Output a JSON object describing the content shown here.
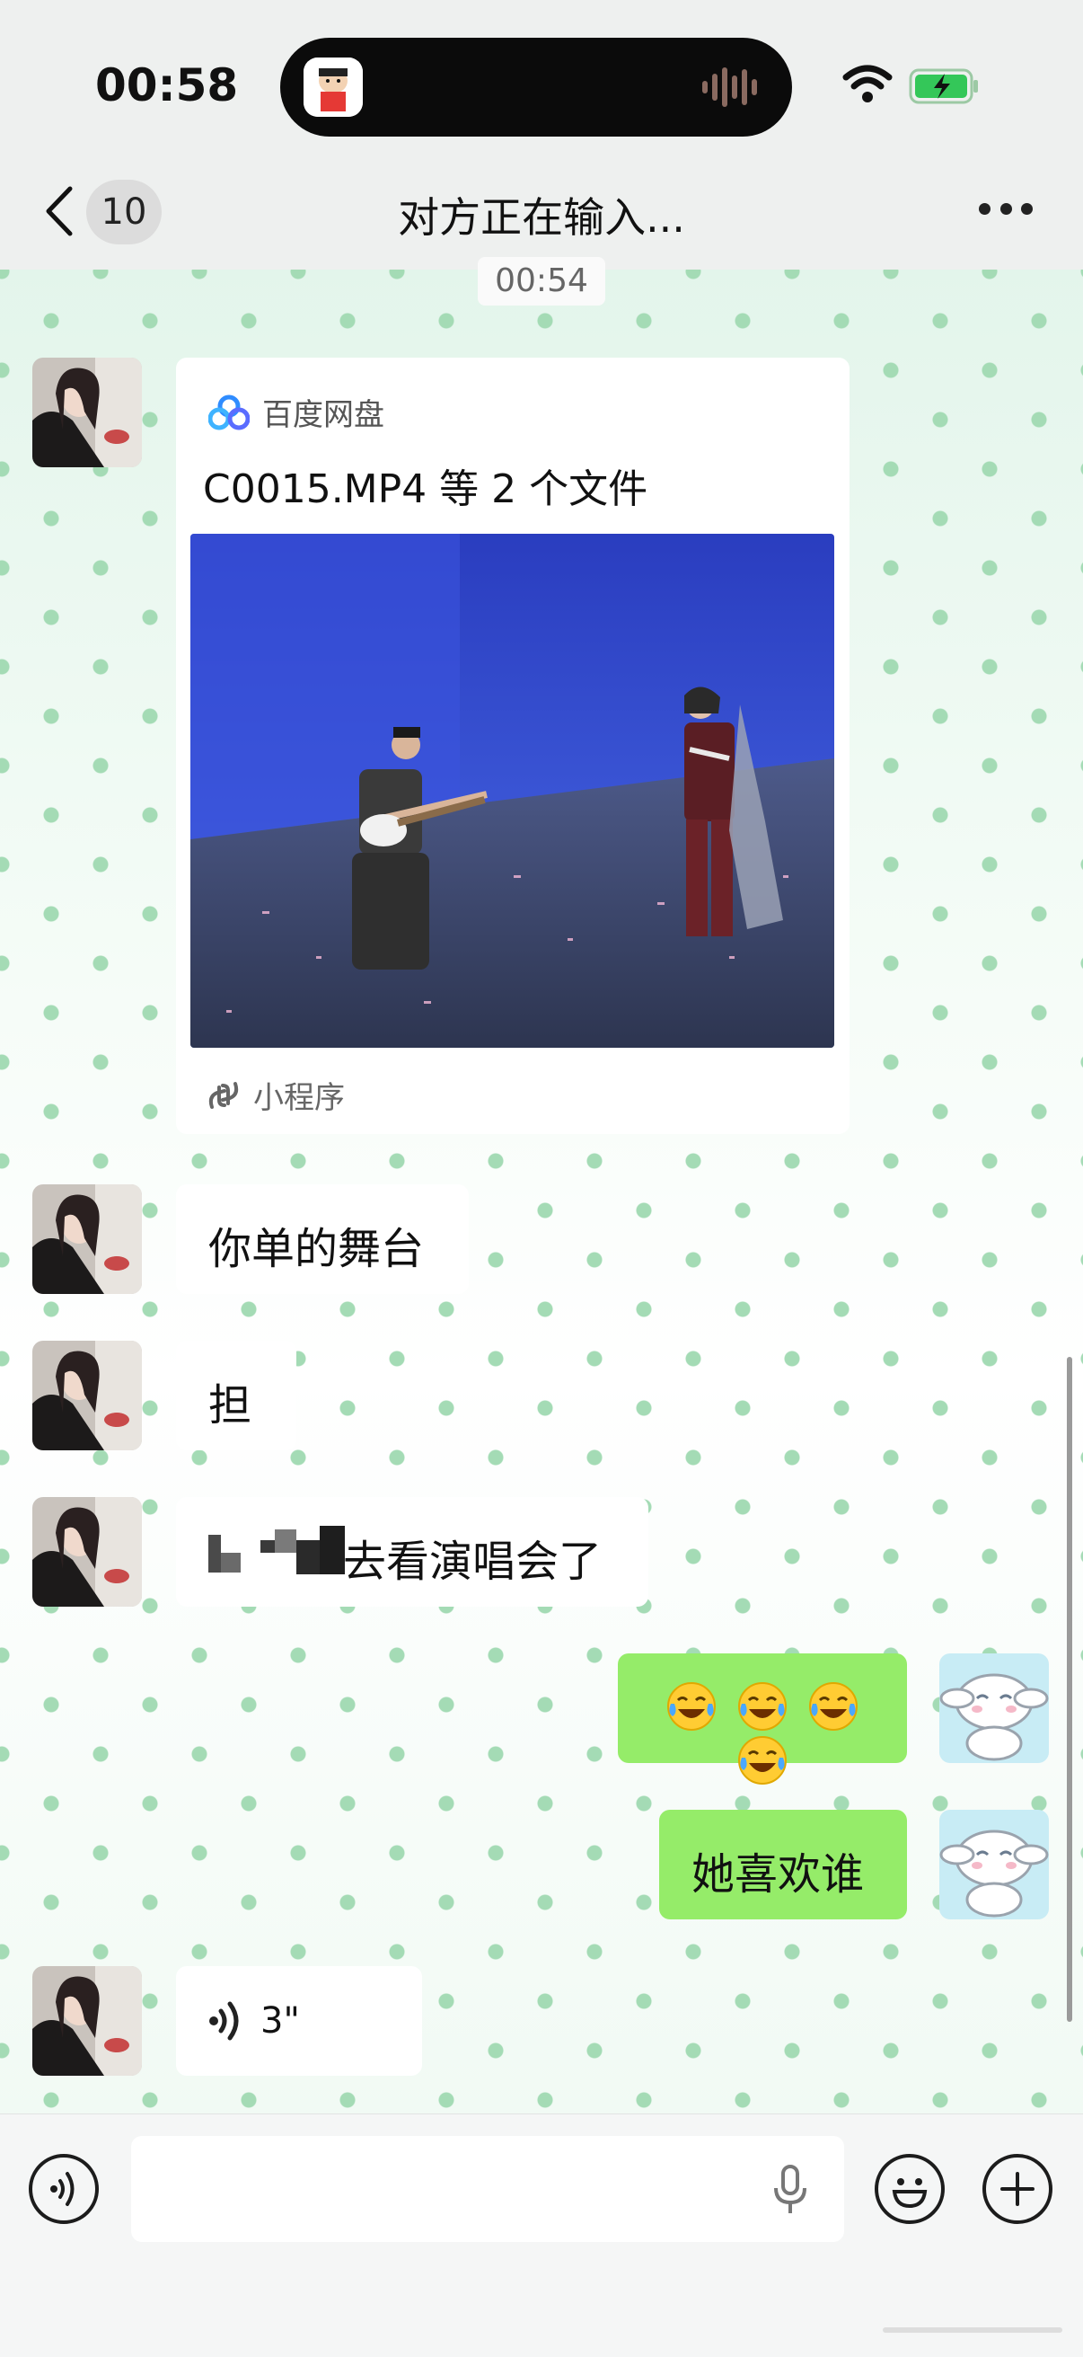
{
  "status_bar": {
    "time": "00:58",
    "battery_color": "#34c759"
  },
  "nav": {
    "unread_count": "10",
    "title": "对方正在输入..."
  },
  "chat": {
    "timestamp": "00:54",
    "messages": [
      {
        "sender": "contact",
        "type": "mini-program-card",
        "brand": "百度网盘",
        "title": "C0015.MP4 等 2 个文件",
        "footer": "小程序"
      },
      {
        "sender": "contact",
        "type": "text",
        "text": "你单的舞台"
      },
      {
        "sender": "contact",
        "type": "text",
        "text": "担"
      },
      {
        "sender": "contact",
        "type": "text",
        "text": "去看演唱会了",
        "redacted_prefix": true
      },
      {
        "sender": "me",
        "type": "emoji",
        "emoji": [
          "face-with-tears-of-joy",
          "face-with-tears-of-joy",
          "face-with-tears-of-joy",
          "face-with-tears-of-joy"
        ]
      },
      {
        "sender": "me",
        "type": "text",
        "text": "她喜欢谁"
      },
      {
        "sender": "contact",
        "type": "voice",
        "duration": "3\""
      }
    ]
  },
  "input_bar": {
    "voice_toggle_icon": "voice-icon",
    "mic_icon": "microphone-icon",
    "emoji_icon": "smiley-icon",
    "more_icon": "plus-icon"
  },
  "colors": {
    "outgoing_bubble": "#95ec69",
    "incoming_bubble": "#ffffff",
    "dot_pattern": "#a4dbb5"
  }
}
